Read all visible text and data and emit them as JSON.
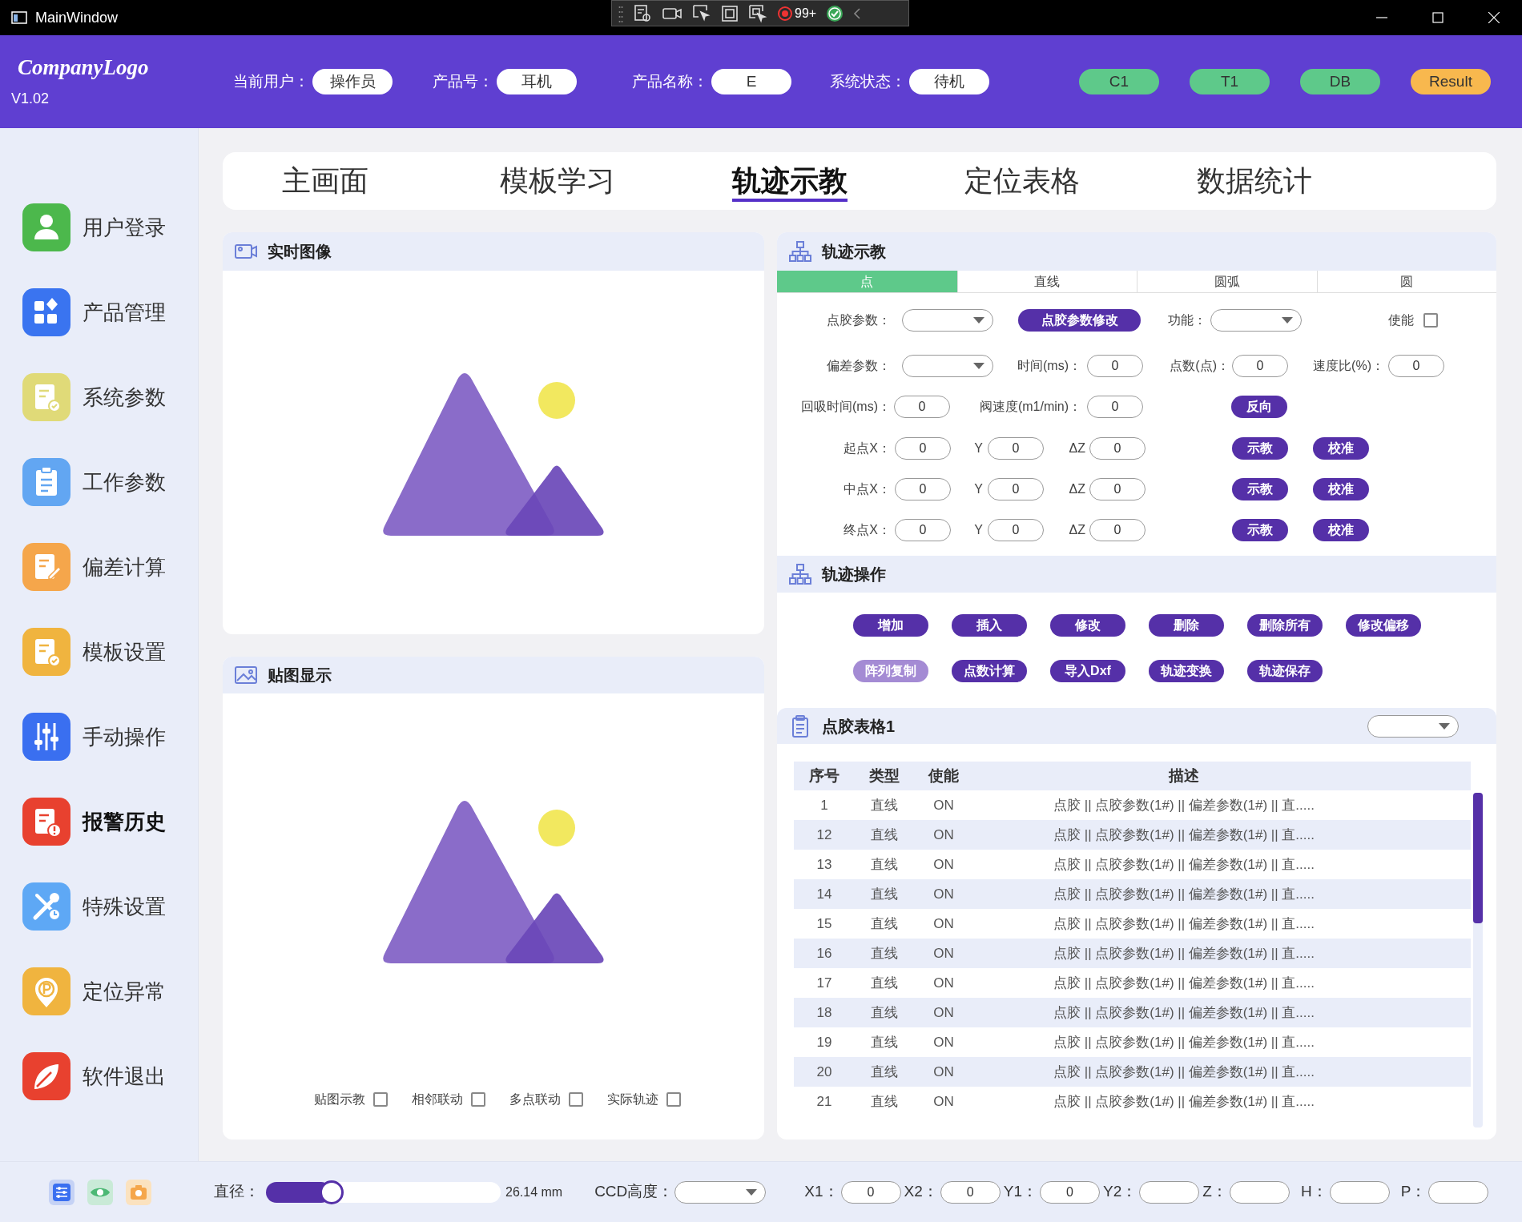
{
  "window": {
    "title": "MainWindow"
  },
  "capture_toolbar": {
    "count": "99+"
  },
  "header": {
    "logo": "CompanyLogo",
    "version": "V1.02",
    "fields": [
      {
        "label": "当前用户：",
        "value": "操作员"
      },
      {
        "label": "产品号：",
        "value": "耳机"
      },
      {
        "label": "产品名称：",
        "value": "E"
      },
      {
        "label": "系统状态：",
        "value": "待机"
      }
    ],
    "status_pills": [
      {
        "label": "C1",
        "color": "#5ec98a"
      },
      {
        "label": "T1",
        "color": "#5ec98a"
      },
      {
        "label": "DB",
        "color": "#5ec98a"
      },
      {
        "label": "Result",
        "color": "#f8b84e"
      }
    ]
  },
  "sidebar": {
    "items": [
      {
        "label": "用户登录",
        "color": "#4cb84c",
        "selected": false
      },
      {
        "label": "产品管理",
        "color": "#3a74f0",
        "selected": false
      },
      {
        "label": "系统参数",
        "color": "#e0da78",
        "selected": false
      },
      {
        "label": "工作参数",
        "color": "#62a6f2",
        "selected": false
      },
      {
        "label": "偏差计算",
        "color": "#f5a64b",
        "selected": false
      },
      {
        "label": "模板设置",
        "color": "#f0b43f",
        "selected": false
      },
      {
        "label": "手动操作",
        "color": "#3a6ff0",
        "selected": false
      },
      {
        "label": "报警历史",
        "color": "#e8412f",
        "selected": true
      },
      {
        "label": "特殊设置",
        "color": "#5ea8f5",
        "selected": false
      },
      {
        "label": "定位异常",
        "color": "#f0b43f",
        "selected": false
      },
      {
        "label": "软件退出",
        "color": "#e8412f",
        "selected": false
      }
    ]
  },
  "tabs": [
    {
      "label": "主画面",
      "selected": false
    },
    {
      "label": "模板学习",
      "selected": false
    },
    {
      "label": "轨迹示教",
      "selected": true
    },
    {
      "label": "定位表格",
      "selected": false
    },
    {
      "label": "数据统计",
      "selected": false
    }
  ],
  "live_image_panel": {
    "title": "实时图像"
  },
  "overlay_panel": {
    "title": "贴图显示",
    "checkboxes": [
      {
        "label": "贴图示教",
        "checked": false
      },
      {
        "label": "相邻联动",
        "checked": false
      },
      {
        "label": "多点联动",
        "checked": false
      },
      {
        "label": "实际轨迹",
        "checked": false
      }
    ]
  },
  "trajectory_teach": {
    "title": "轨迹示教",
    "modes": [
      {
        "label": "点",
        "selected": true
      },
      {
        "label": "直线",
        "selected": false
      },
      {
        "label": "圆弧",
        "selected": false
      },
      {
        "label": "圆",
        "selected": false
      }
    ],
    "rows": [
      {
        "items": [
          {
            "kind": "label",
            "text": "点胶参数："
          },
          {
            "kind": "dropdown"
          },
          {
            "kind": "button",
            "text": "点胶参数修改"
          },
          {
            "kind": "label",
            "text": "功能："
          },
          {
            "kind": "dropdown"
          },
          {
            "kind": "label",
            "text": "使能"
          },
          {
            "kind": "checkbox",
            "checked": false
          }
        ]
      },
      {
        "items": [
          {
            "kind": "label",
            "text": "偏差参数："
          },
          {
            "kind": "dropdown"
          },
          {
            "kind": "label",
            "text": "时间(ms)："
          },
          {
            "kind": "field",
            "value": "0"
          },
          {
            "kind": "label",
            "text": "点数(点)："
          },
          {
            "kind": "field",
            "value": "0"
          },
          {
            "kind": "label",
            "text": "速度比(%)："
          },
          {
            "kind": "field",
            "value": "0"
          }
        ]
      },
      {
        "items": [
          {
            "kind": "label",
            "text": "回吸时间(ms)："
          },
          {
            "kind": "field",
            "value": "0"
          },
          {
            "kind": "label",
            "text": "阀速度(m1/min)："
          },
          {
            "kind": "field",
            "value": "0"
          },
          {
            "kind": "button",
            "text": "反向"
          }
        ]
      },
      {
        "items": [
          {
            "kind": "label",
            "text": "起点X："
          },
          {
            "kind": "field",
            "value": "0"
          },
          {
            "kind": "label",
            "text": "Y"
          },
          {
            "kind": "field",
            "value": "0"
          },
          {
            "kind": "label",
            "text": "ΔZ"
          },
          {
            "kind": "field",
            "value": "0"
          },
          {
            "kind": "button",
            "text": "示教"
          },
          {
            "kind": "button",
            "text": "校准"
          }
        ]
      },
      {
        "items": [
          {
            "kind": "label",
            "text": "中点X："
          },
          {
            "kind": "field",
            "value": "0"
          },
          {
            "kind": "label",
            "text": "Y"
          },
          {
            "kind": "field",
            "value": "0"
          },
          {
            "kind": "label",
            "text": "ΔZ"
          },
          {
            "kind": "field",
            "value": "0"
          },
          {
            "kind": "button",
            "text": "示教"
          },
          {
            "kind": "button",
            "text": "校准"
          }
        ]
      },
      {
        "items": [
          {
            "kind": "label",
            "text": "终点X："
          },
          {
            "kind": "field",
            "value": "0"
          },
          {
            "kind": "label",
            "text": "Y"
          },
          {
            "kind": "field",
            "value": "0"
          },
          {
            "kind": "label",
            "text": "ΔZ"
          },
          {
            "kind": "field",
            "value": "0"
          },
          {
            "kind": "button",
            "text": "示教"
          },
          {
            "kind": "button",
            "text": "校准"
          }
        ]
      }
    ]
  },
  "trajectory_ops": {
    "title": "轨迹操作",
    "button_rows": [
      [
        {
          "label": "增加",
          "disabled": false
        },
        {
          "label": "插入",
          "disabled": false
        },
        {
          "label": "修改",
          "disabled": false
        },
        {
          "label": "删除",
          "disabled": false
        },
        {
          "label": "删除所有",
          "disabled": false
        },
        {
          "label": "修改偏移",
          "disabled": false
        }
      ],
      [
        {
          "label": "阵列复制",
          "disabled": true
        },
        {
          "label": "点数计算",
          "disabled": false
        },
        {
          "label": "导入Dxf",
          "disabled": false
        },
        {
          "label": "轨迹变换",
          "disabled": false
        },
        {
          "label": "轨迹保存",
          "disabled": false
        }
      ]
    ]
  },
  "glue_table": {
    "title": "点胶表格1",
    "columns": [
      "序号",
      "类型",
      "使能",
      "描述"
    ],
    "rows": [
      [
        "1",
        "直线",
        "ON",
        "点胶 || 点胶参数(1#) || 偏差参数(1#) || 直....."
      ],
      [
        "12",
        "直线",
        "ON",
        "点胶 || 点胶参数(1#) || 偏差参数(1#) || 直....."
      ],
      [
        "13",
        "直线",
        "ON",
        "点胶 || 点胶参数(1#) || 偏差参数(1#) || 直....."
      ],
      [
        "14",
        "直线",
        "ON",
        "点胶 || 点胶参数(1#) || 偏差参数(1#) || 直....."
      ],
      [
        "15",
        "直线",
        "ON",
        "点胶 || 点胶参数(1#) || 偏差参数(1#) || 直....."
      ],
      [
        "16",
        "直线",
        "ON",
        "点胶 || 点胶参数(1#) || 偏差参数(1#) || 直....."
      ],
      [
        "17",
        "直线",
        "ON",
        "点胶 || 点胶参数(1#) || 偏差参数(1#) || 直....."
      ],
      [
        "18",
        "直线",
        "ON",
        "点胶 || 点胶参数(1#) || 偏差参数(1#) || 直....."
      ],
      [
        "19",
        "直线",
        "ON",
        "点胶 || 点胶参数(1#) || 偏差参数(1#) || 直....."
      ],
      [
        "20",
        "直线",
        "ON",
        "点胶 || 点胶参数(1#) || 偏差参数(1#) || 直....."
      ],
      [
        "21",
        "直线",
        "ON",
        "点胶 || 点胶参数(1#) || 偏差参数(1#) || 直....."
      ]
    ]
  },
  "bottom_bar": {
    "diameter": {
      "label": "直径：",
      "level": 0.28,
      "reading": "26.14 mm"
    },
    "ccd": {
      "label": "CCD高度："
    },
    "coords": [
      {
        "label": "X1：",
        "value": "0"
      },
      {
        "label": "X2：",
        "value": "0"
      },
      {
        "label": "Y1：",
        "value": "0"
      },
      {
        "label": "Y2："
      },
      {
        "label": "Z："
      },
      {
        "label": "H："
      },
      {
        "label": "P："
      }
    ]
  }
}
